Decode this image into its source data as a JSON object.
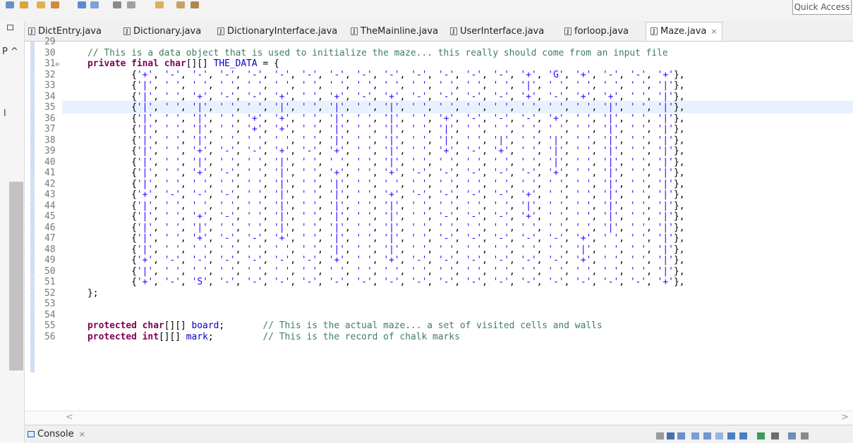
{
  "toolbar": {
    "quick_access_placeholder": "Quick Access"
  },
  "left_panel": {
    "text1": "P ^",
    "text2": "l"
  },
  "tabs": [
    {
      "label": "DictEntry.java",
      "active": false
    },
    {
      "label": "Dictionary.java",
      "active": false
    },
    {
      "label": "DictionaryInterface.java",
      "active": false
    },
    {
      "label": "TheMainline.java",
      "active": false
    },
    {
      "label": "UserInterface.java",
      "active": false
    },
    {
      "label": "forloop.java",
      "active": false
    },
    {
      "label": "Maze.java",
      "active": true,
      "close": "×"
    }
  ],
  "editor": {
    "file": "Maze.java",
    "highlighted_line": 34,
    "lines": [
      {
        "n": "29",
        "text": ""
      },
      {
        "n": "30",
        "text": "    // This is a data object that is used to initialize the maze... this really should come from an input file"
      },
      {
        "n": "31",
        "text": "    private final char[][] THE_DATA = {",
        "fold": "⊖"
      },
      {
        "n": "32",
        "text": "            {'+', '-', '-', '-', '-', '-', '-', '-', '-', '-', '-', '-', '-', '-', '+', 'G', '+', '-', '-', '+'},"
      },
      {
        "n": "33",
        "text": "            {'|', ' ', ' ', ' ', ' ', ' ', ' ', ' ', ' ', ' ', ' ', ' ', ' ', ' ', '|', ' ', ' ', ' ', ' ', '|'},"
      },
      {
        "n": "34",
        "text": "            {'|', ' ', '+', '-', '-', '+', ' ', '+', '-', '+', '-', '-', '-', '-', '+', '-', '+', '+', ' ', '|'},"
      },
      {
        "n": "35",
        "text": "            {'|', ' ', '|', ' ', ' ', '|', ' ', '|', ' ', '|', ' ', ' ', ' ', ' ', ' ', ' ', ' ', '|', ' ', '|'},"
      },
      {
        "n": "36",
        "text": "            {'|', ' ', '|', ' ', '+', '+', ' ', '|', ' ', '|', ' ', '+', '-', '-', '-', '+', ' ', '|', ' ', '|'},"
      },
      {
        "n": "37",
        "text": "            {'|', ' ', '|', ' ', '+', '+', ' ', '|', ' ', '|', ' ', '|', ' ', ' ', ' ', ' ', ' ', '|', ' ', '|'},"
      },
      {
        "n": "38",
        "text": "            {'|', ' ', '|', ' ', ' ', ' ', ' ', '|', ' ', '|', ' ', '|', ' ', '|', ' ', '|', ' ', '|', ' ', '|'},"
      },
      {
        "n": "39",
        "text": "            {'|', ' ', '+', '-', '-', '+', '-', '+', ' ', '|', ' ', '+', '-', '+', ' ', '|', ' ', '|', ' ', '|'},"
      },
      {
        "n": "40",
        "text": "            {'|', ' ', '|', ' ', ' ', '|', ' ', ' ', ' ', '|', ' ', ' ', ' ', ' ', ' ', '|', ' ', '|', ' ', '|'},"
      },
      {
        "n": "41",
        "text": "            {'|', ' ', '+', '-', ' ', '|', ' ', '+', ' ', '+', '-', '-', '-', '-', '-', '+', ' ', '|', ' ', '|'},"
      },
      {
        "n": "42",
        "text": "            {'|', ' ', ' ', ' ', ' ', '|', ' ', '|', ' ', ' ', ' ', ' ', ' ', ' ', ' ', ' ', ' ', '|', ' ', '|'},"
      },
      {
        "n": "43",
        "text": "            {'+', '-', '-', '-', ' ', '|', ' ', '|', ' ', '+', '-', '-', '-', '-', '+', ' ', ' ', '|', ' ', '|'},"
      },
      {
        "n": "44",
        "text": "            {'|', ' ', ' ', ' ', ' ', '|', ' ', '|', ' ', '|', ' ', ' ', ' ', ' ', '|', ' ', ' ', '|', ' ', '|'},"
      },
      {
        "n": "45",
        "text": "            {'|', ' ', '+', '-', ' ', '|', ' ', '|', ' ', '|', ' ', '-', '-', '-', '+', ' ', ' ', '|', ' ', '|'},"
      },
      {
        "n": "46",
        "text": "            {'|', ' ', '|', ' ', ' ', '|', ' ', '|', ' ', '|', ' ', ' ', ' ', ' ', ' ', ' ', ' ', '|', ' ', '|'},"
      },
      {
        "n": "47",
        "text": "            {'|', ' ', '+', '-', '-', '+', ' ', '|', ' ', '|', ' ', '-', '-', '-', '-', '-', '+', ' ', ' ', '|'},"
      },
      {
        "n": "48",
        "text": "            {'|', ' ', ' ', ' ', ' ', ' ', ' ', '|', ' ', '|', ' ', ' ', ' ', ' ', ' ', ' ', '|', ' ', ' ', '|'},"
      },
      {
        "n": "49",
        "text": "            {'+', '-', '-', '-', '-', '-', '-', '+', ' ', '+', '-', '-', '-', '-', '-', '-', '+', ' ', ' ', '|'},"
      },
      {
        "n": "50",
        "text": "            {'|', ' ', ' ', ' ', ' ', ' ', ' ', ' ', ' ', ' ', ' ', ' ', ' ', ' ', ' ', ' ', ' ', ' ', ' ', '|'},"
      },
      {
        "n": "51",
        "text": "            {'+', '-', 'S', '-', '-', '-', '-', '-', '-', '-', '-', '-', '-', '-', '-', '-', '-', '-', '-', '+'},"
      },
      {
        "n": "52",
        "text": "    };"
      },
      {
        "n": "53",
        "text": ""
      },
      {
        "n": "54",
        "text": ""
      },
      {
        "n": "55",
        "text": "    protected char[][] board;       // This is the actual maze... a set of visited cells and walls"
      },
      {
        "n": "56",
        "text": "    protected int[][] mark;         // This is the record of chalk marks"
      }
    ]
  },
  "scroll": {
    "left_arrow": "<",
    "right_arrow": ">"
  },
  "console": {
    "label": "Console",
    "close": "×"
  },
  "colors": {
    "keyword": "#7f0055",
    "field": "#0000c0",
    "comment": "#3f7f5f",
    "char_literal": "#2a00ff",
    "line_number": "#787878",
    "current_line": "#e8f2fe"
  }
}
